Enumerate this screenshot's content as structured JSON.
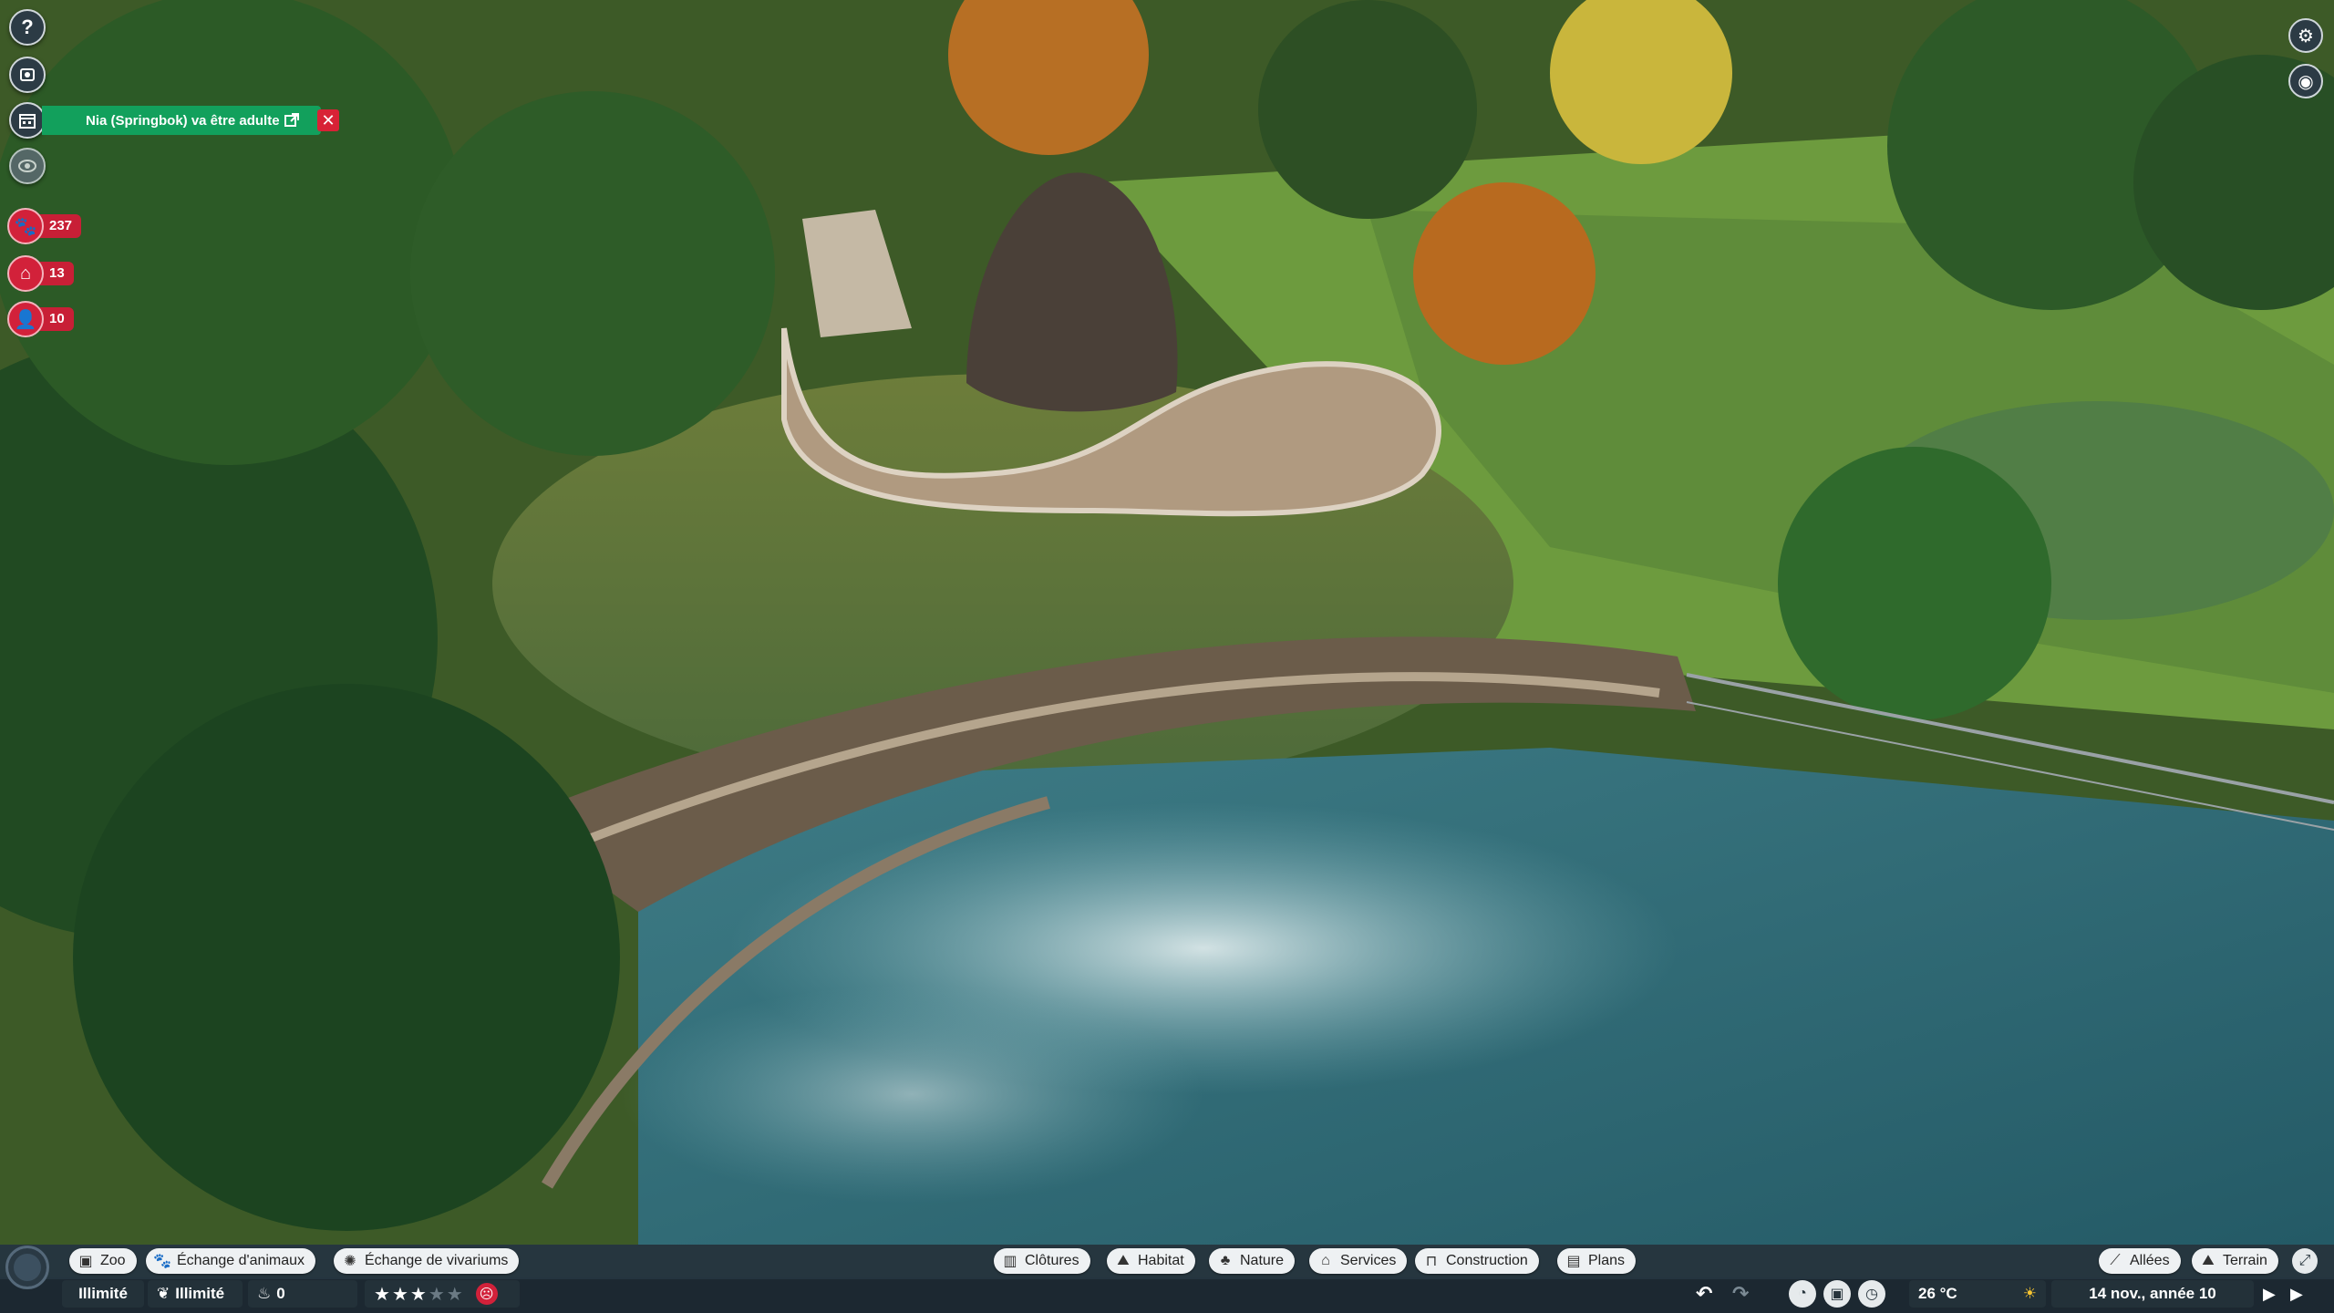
{
  "left_sidebar": {
    "help_icon": "question-icon",
    "buttons": [
      "zoo-icon",
      "calendar-icon",
      "eye-icon"
    ],
    "stats": [
      {
        "icon": "paw-icon",
        "value": "237"
      },
      {
        "icon": "arch-icon",
        "value": "13"
      },
      {
        "icon": "person-icon",
        "value": "10"
      }
    ]
  },
  "notification": {
    "text": "Nia (Springbok) va être adulte"
  },
  "toolbar": {
    "left_tabs": [
      {
        "label": "Zoo",
        "icon": "zoo-icon"
      },
      {
        "label": "Échange d'animaux",
        "icon": "paw-icon"
      },
      {
        "label": "Échange de vivariums",
        "icon": "bug-icon"
      }
    ],
    "center_tabs": [
      {
        "label": "Clôtures",
        "icon": "fence-icon"
      },
      {
        "label": "Habitat",
        "icon": "habitat-icon"
      },
      {
        "label": "Nature",
        "icon": "tree-icon"
      },
      {
        "label": "Services",
        "icon": "shop-icon"
      },
      {
        "label": "Construction",
        "icon": "build-icon"
      },
      {
        "label": "Plans",
        "icon": "blueprint-icon"
      }
    ],
    "right_tabs": [
      {
        "label": "Allées",
        "icon": "path-icon"
      },
      {
        "label": "Terrain",
        "icon": "terrain-icon"
      }
    ],
    "status": {
      "money": "Illimité",
      "research": "Illimité",
      "conservation": "0",
      "rating_stars": 3,
      "rating_max": 5,
      "temperature": "26 °C",
      "date": "14 nov., année 10"
    }
  },
  "colors": {
    "notification": "#12a05c",
    "alert_red": "#d2213a",
    "toolbar": "#26363f"
  }
}
